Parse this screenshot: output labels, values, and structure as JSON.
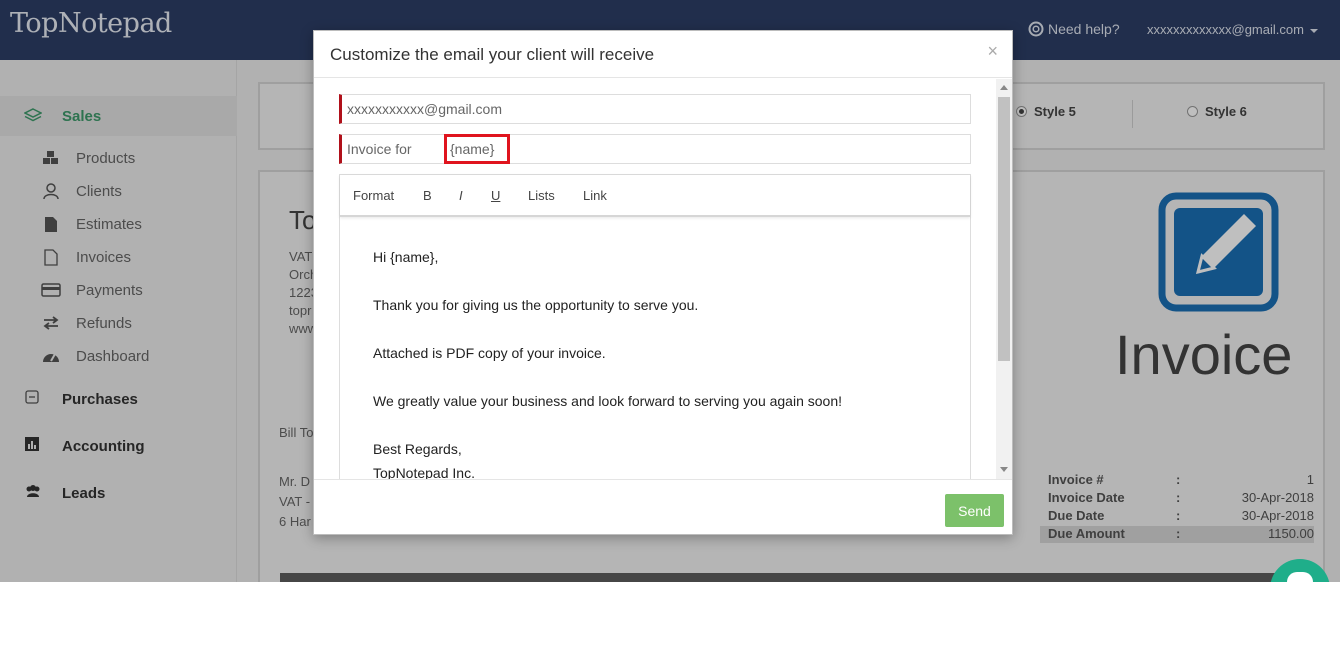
{
  "app": {
    "logo": "TopNotepad"
  },
  "header": {
    "help_label": "Need help?",
    "user_email": "xxxxxxxxxxxxx@gmail.com"
  },
  "sidebar": {
    "section": "Sales",
    "items": [
      {
        "label": "Products",
        "icon": "cubes-icon"
      },
      {
        "label": "Clients",
        "icon": "user-icon"
      },
      {
        "label": "Estimates",
        "icon": "file-icon"
      },
      {
        "label": "Invoices",
        "icon": "file-outline-icon"
      },
      {
        "label": "Payments",
        "icon": "credit-card-icon"
      },
      {
        "label": "Refunds",
        "icon": "exchange-icon"
      },
      {
        "label": "Dashboard",
        "icon": "tachometer-icon"
      }
    ],
    "groups": [
      {
        "label": "Purchases",
        "icon": "minus-square-icon"
      },
      {
        "label": "Accounting",
        "icon": "bar-chart-icon"
      },
      {
        "label": "Leads",
        "icon": "users-icon"
      }
    ]
  },
  "styles": {
    "style5": "Style 5",
    "style6": "Style 6"
  },
  "invoice": {
    "company_partial": "To",
    "address_lines": [
      "VAT",
      "Orch",
      "1223",
      "topr",
      "www"
    ],
    "bill_to": "Bill To",
    "client_lines": [
      "Mr. D",
      "VAT -",
      "6 Har"
    ],
    "title": "Invoice",
    "meta": [
      {
        "key": "Invoice #",
        "value": "1"
      },
      {
        "key": "Invoice Date",
        "value": "30-Apr-2018"
      },
      {
        "key": "Due Date",
        "value": "30-Apr-2018"
      },
      {
        "key": "Due Amount",
        "value": "1150.00"
      }
    ],
    "colon": ":"
  },
  "modal": {
    "title": "Customize the email your client will receive",
    "close": "×",
    "to_value": "xxxxxxxxxxx@gmail.com",
    "subject_prefix": "Invoice for",
    "subject_token": "{name}",
    "toolbar": {
      "format": "Format",
      "bold": "B",
      "italic": "I",
      "underline": "U",
      "lists": "Lists",
      "link": "Link"
    },
    "body": {
      "greeting": "Hi {name},",
      "line1": "Thank you for giving us the opportunity to serve you.",
      "line2": "Attached is PDF copy of your invoice.",
      "line3": "We greatly value your business and look forward to serving you again soon!",
      "closing": "Best Regards,",
      "signature": "TopNotepad Inc."
    },
    "send_label": "Send"
  },
  "colors": {
    "header_bg": "#2c3e66",
    "accent_green": "#3e9a6b",
    "send_green": "#7cc16a",
    "required_red": "#b0101a",
    "highlight_red": "#e0141e",
    "invoice_icon_blue": "#1a6fb5"
  }
}
